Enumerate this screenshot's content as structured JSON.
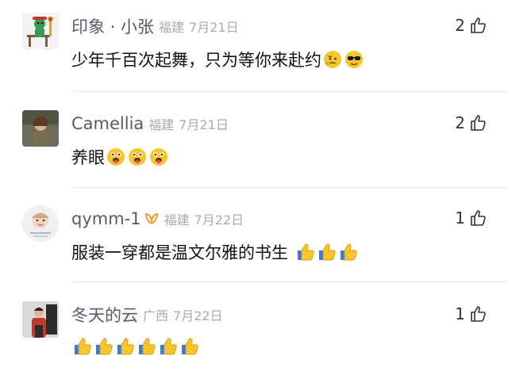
{
  "comments": [
    {
      "name": "印象 · 小张",
      "location": "福建",
      "time": "7月21日",
      "text": "少年千百次起舞，只为等你来赴约",
      "emojis": [
        "thinking-face-emoji",
        "sunglasses-face-emoji"
      ],
      "likes": "2"
    },
    {
      "name": "Camellia",
      "location": "福建",
      "time": "7月21日",
      "text": "养眼",
      "emojis": [
        "tongue-face-emoji",
        "tongue-face-emoji",
        "tongue-face-emoji"
      ],
      "likes": "2"
    },
    {
      "name": "qymm-1",
      "location": "福建",
      "time": "7月22日",
      "text": "服装一穿都是温文尔雅的书生",
      "emojis": [
        "thumbs-up-emoji",
        "thumbs-up-emoji",
        "thumbs-up-emoji"
      ],
      "likes": "1"
    },
    {
      "name": "冬天的云",
      "location": "广西",
      "time": "7月22日",
      "text": "",
      "emojis": [
        "thumbs-up-emoji",
        "thumbs-up-emoji",
        "thumbs-up-emoji",
        "thumbs-up-emoji",
        "thumbs-up-emoji",
        "thumbs-up-emoji"
      ],
      "likes": "1"
    }
  ],
  "colors": {
    "name": "#575b66",
    "meta": "#a7aab3",
    "badge_orange": "#f29a38",
    "emoji_yellow": "#f7c52c"
  }
}
